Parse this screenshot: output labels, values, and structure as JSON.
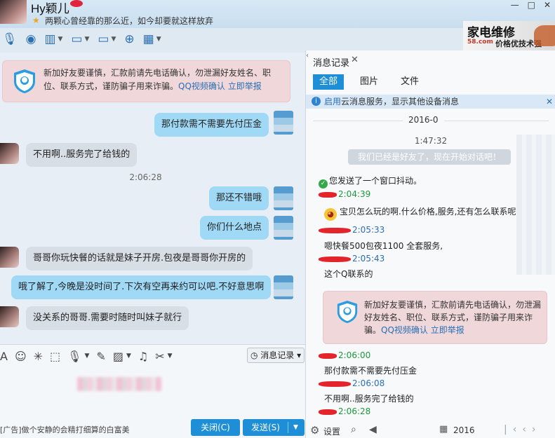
{
  "header": {
    "nickname": "Hy颖儿",
    "signature": "两颗心曾经靠的那么近，如今却要就这样放弃",
    "window_buttons": [
      "—",
      "□",
      "✕"
    ],
    "toolbar_icons": [
      "microphone-icon",
      "camera-icon",
      "screen-share-icon",
      "file-transfer-icon",
      "remote-assist-icon",
      "message-add-icon",
      "apps-icon"
    ]
  },
  "ad": {
    "title": "家电维修",
    "logo": "58.com",
    "subtitle": "价格优技术强"
  },
  "chat": {
    "notice": {
      "text": "新加好友要谨慎，汇款前请先电话确认，勿泄漏好友姓名、职位、联系方式，谨防骗子用来诈骗。",
      "link_video": "QQ视频确认",
      "link_report": "立即举报"
    },
    "messages": [
      {
        "side": "me",
        "text": "那付款需不需要先付压金"
      },
      {
        "side": "peer",
        "text": "不用啊..服务完了给钱的"
      },
      {
        "side": "time",
        "text": "2:06:28"
      },
      {
        "side": "me",
        "text": "那还不错哦"
      },
      {
        "side": "me",
        "text": "你们什么地点"
      },
      {
        "side": "peer",
        "text": "哥哥你玩快餐的话就是妹子开房.包夜是哥哥你开房的"
      },
      {
        "side": "me",
        "text": "哦了解了,今晚是没时间了.下次有空再来约可以吧.不好意思啊"
      },
      {
        "side": "peer",
        "text": "没关系的哥哥.需要时随时叫妹子就行"
      }
    ]
  },
  "input": {
    "history_button": "消息记录",
    "ad_text": "[广告]做个安静的会精打细算的白富美",
    "close_button": "关闭(C)",
    "send_button": "发送(S)"
  },
  "history": {
    "title": "消息记录",
    "tabs": [
      "全部",
      "图片",
      "文件"
    ],
    "cloud_text_link": "启用",
    "cloud_text": "云消息服务，显示其他设备消息",
    "date": "2016-0",
    "first_time": "1:47:32",
    "friend_pill": "我们已经是好友了，现在开始对话吧！",
    "entries": [
      {
        "time": "",
        "text": "您发送了一个窗口抖动。",
        "name_color": "none"
      },
      {
        "time": "2:04:39",
        "text": "宝贝怎么玩的啊.什么价格,服务,还有怎么联系呢",
        "name_color": "green"
      },
      {
        "time": "2:05:33",
        "text": "嗯快餐500包夜1100  全套服务,",
        "name_color": "blue"
      },
      {
        "time": "2:05:43",
        "text": "这个Q联系的",
        "name_color": "blue"
      },
      {
        "time": "2:06:00",
        "text": "那付款需不需要先付压金",
        "name_color": "green"
      },
      {
        "time": "2:06:08",
        "text": "不用啊..服务完了给钱的",
        "name_color": "blue"
      },
      {
        "time": "2:06:28",
        "text": "",
        "name_color": "green"
      }
    ],
    "notice": {
      "text": "新加好友要谨慎，汇款前请先电话确认，勿泄漏好友姓名、职位、联系方式，谨防骗子用来诈骗。",
      "link_video": "QQ视频确认",
      "link_report": "立即举报"
    },
    "footer_settings": "设置",
    "footer_date": "2016"
  }
}
